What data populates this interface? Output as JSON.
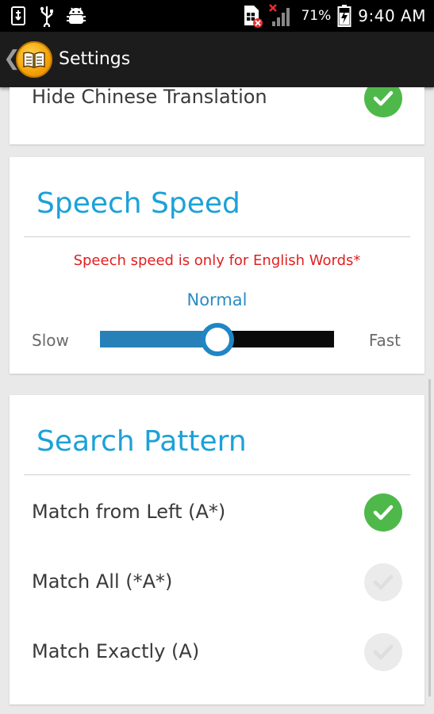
{
  "status_bar": {
    "battery_percent": "71%",
    "time": "9:40 AM"
  },
  "app_bar": {
    "title": "Settings"
  },
  "hide_translation": {
    "label": "Hide Chinese Translation",
    "checked": true
  },
  "speech_speed": {
    "title": "Speech Speed",
    "note": "Speech speed is only for English Words*",
    "value_label": "Normal",
    "slow_label": "Slow",
    "fast_label": "Fast",
    "level": 0.5
  },
  "search_pattern": {
    "title": "Search Pattern",
    "options": [
      {
        "label": "Match from Left (A*)",
        "checked": true
      },
      {
        "label": "Match All (*A*)",
        "checked": false
      },
      {
        "label": "Match Exactly (A)",
        "checked": false
      }
    ]
  },
  "colors": {
    "accent": "#1ca1d8",
    "check_on": "#4fb84a",
    "warning_text": "#e02020"
  }
}
